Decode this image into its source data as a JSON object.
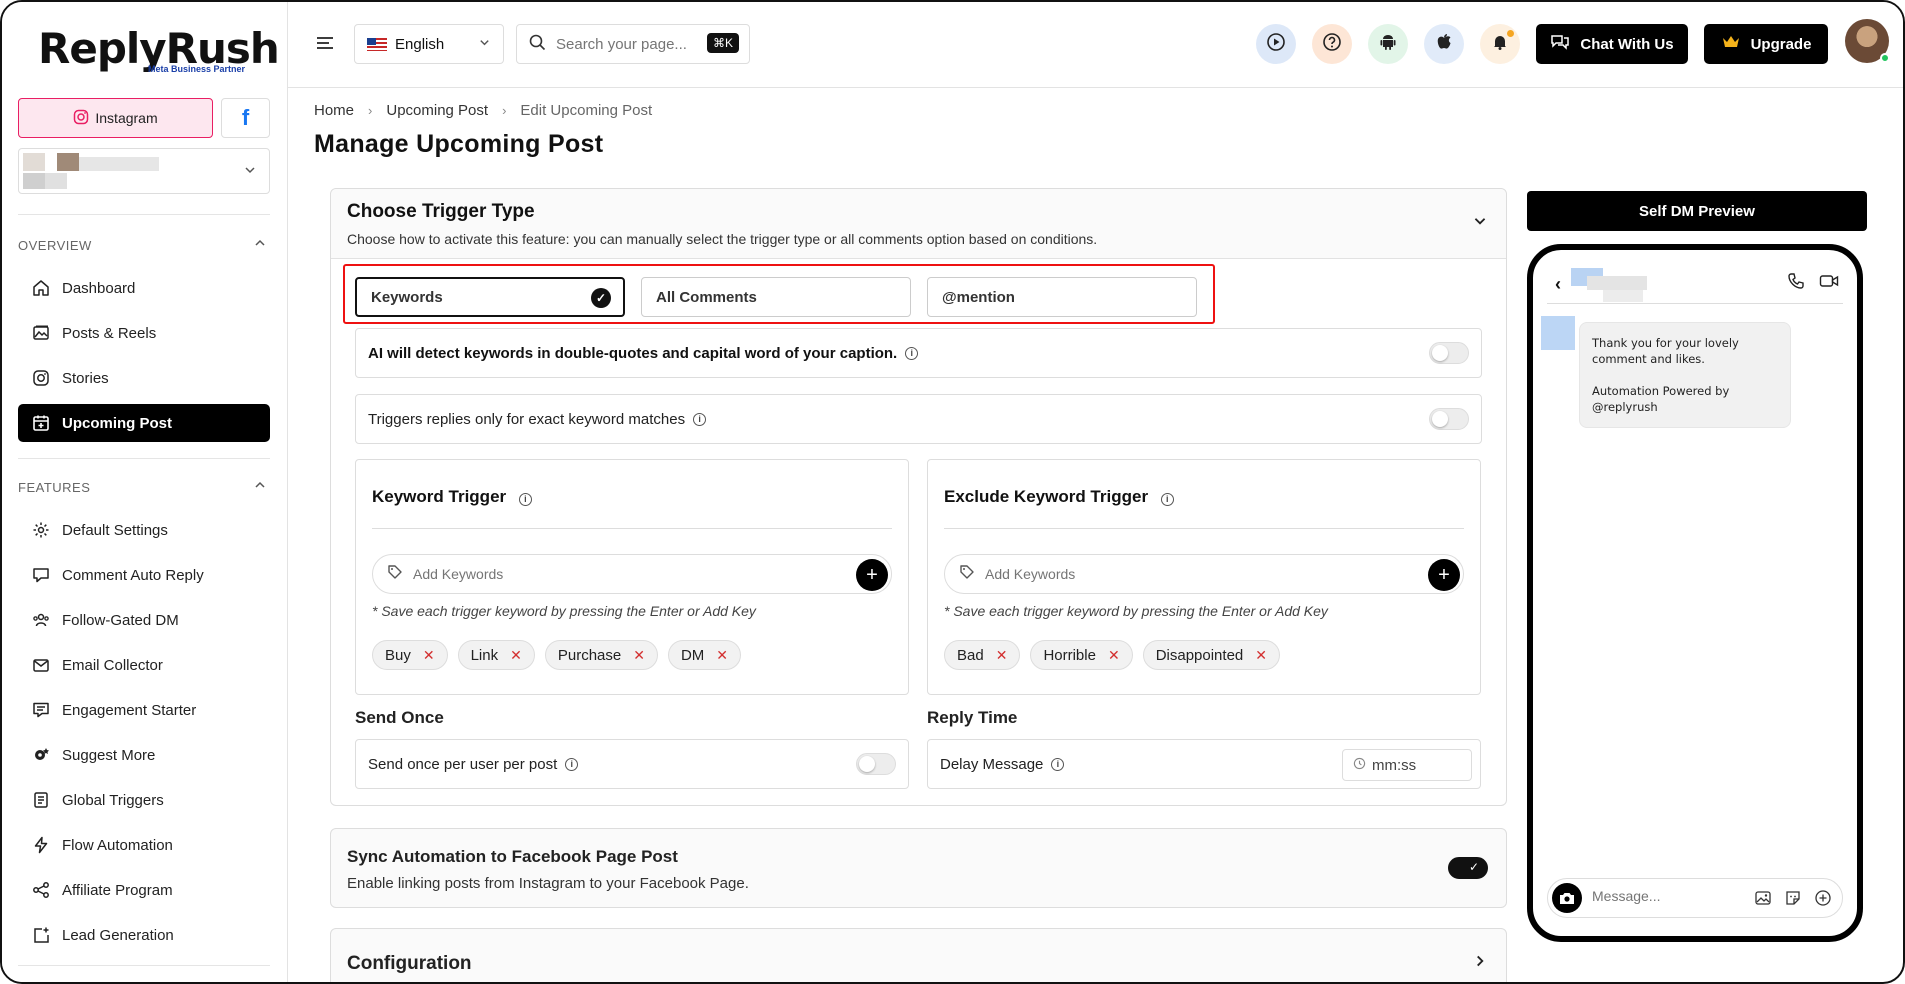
{
  "app": {
    "logo": "ReplyRush",
    "logo_sub": "Meta Business Partner"
  },
  "sidebar": {
    "instagram_label": "Instagram",
    "facebook_label": "f",
    "overview_header": "OVERVIEW",
    "features_header": "FEATURES",
    "overview_items": [
      {
        "label": "Dashboard",
        "icon": "home-icon"
      },
      {
        "label": "Posts & Reels",
        "icon": "image-icon"
      },
      {
        "label": "Stories",
        "icon": "instagram-icon"
      },
      {
        "label": "Upcoming Post",
        "icon": "calendar-plus-icon",
        "active": true
      }
    ],
    "feature_items": [
      {
        "label": "Default Settings",
        "icon": "gear-icon"
      },
      {
        "label": "Comment Auto Reply",
        "icon": "comment-icon"
      },
      {
        "label": "Follow-Gated DM",
        "icon": "users-icon"
      },
      {
        "label": "Email Collector",
        "icon": "mail-icon"
      },
      {
        "label": "Engagement Starter",
        "icon": "chat-list-icon"
      },
      {
        "label": "Suggest More",
        "icon": "gear-star-icon"
      },
      {
        "label": "Global Triggers",
        "icon": "book-icon"
      },
      {
        "label": "Flow Automation",
        "icon": "bolt-icon"
      },
      {
        "label": "Affiliate Program",
        "icon": "share-icon"
      },
      {
        "label": "Lead Generation",
        "icon": "lead-icon"
      }
    ]
  },
  "header": {
    "language": "English",
    "search_placeholder": "Search your page...",
    "search_shortcut": "⌘K",
    "chat_label": "Chat With Us",
    "upgrade_label": "Upgrade"
  },
  "breadcrumb": {
    "home": "Home",
    "parent": "Upcoming Post",
    "current": "Edit Upcoming Post"
  },
  "page_title": "Manage Upcoming Post",
  "trigger_card": {
    "title": "Choose Trigger Type",
    "description": "Choose how to activate this feature: you can manually select the trigger type or all comments option based on conditions.",
    "options": [
      "Keywords",
      "All Comments",
      "@mention"
    ],
    "selected": "Keywords",
    "ai_detect_label": "AI will detect keywords in double-quotes and capital word of your caption.",
    "ai_detect_enabled": false,
    "exact_match_label": "Triggers replies only for exact keyword matches",
    "exact_match_enabled": false,
    "keyword_trigger": {
      "title": "Keyword Trigger",
      "placeholder": "Add Keywords",
      "hint": "* Save each trigger keyword by pressing the Enter or Add Key",
      "chips": [
        "Buy",
        "Link",
        "Purchase",
        "DM"
      ]
    },
    "exclude_trigger": {
      "title": "Exclude Keyword Trigger",
      "placeholder": "Add Keywords",
      "hint": "* Save each trigger keyword by pressing the Enter or Add Key",
      "chips": [
        "Bad",
        "Horrible",
        "Disappointed"
      ]
    },
    "send_once": {
      "label": "Send Once",
      "row_label": "Send once per user per post",
      "enabled": false
    },
    "reply_time": {
      "label": "Reply Time",
      "row_label": "Delay Message",
      "placeholder": "mm:ss"
    }
  },
  "sync_card": {
    "title": "Sync Automation to Facebook Page Post",
    "description": "Enable linking posts from Instagram to your Facebook Page.",
    "enabled": true
  },
  "config_card": {
    "title": "Configuration"
  },
  "preview": {
    "button_label": "Self DM Preview",
    "message": "Thank you for your lovely comment and likes.\n\nAutomation Powered by @replyrush",
    "composer_placeholder": "Message..."
  },
  "colors": {
    "accent": "#000000",
    "highlight_border": "#ee1111",
    "instagram_bg": "#fde7ef",
    "chip_remove": "#d32f2f"
  }
}
